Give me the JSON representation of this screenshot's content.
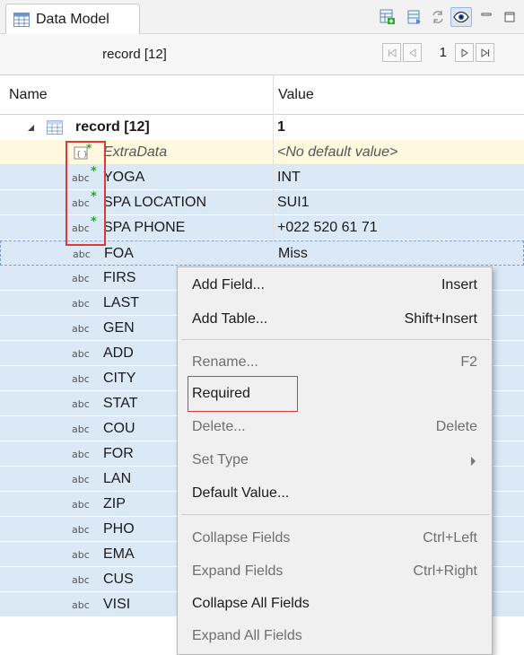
{
  "window": {
    "tab_label": "Data Model"
  },
  "nav": {
    "title": "record [12]",
    "page": "1"
  },
  "header": {
    "name": "Name",
    "value": "Value"
  },
  "tree": {
    "root": {
      "name": "record [12]",
      "value": "1"
    },
    "rows": [
      {
        "name": "ExtraData",
        "value": "<No default value>",
        "icon": "extradata-icon",
        "style": "extra"
      },
      {
        "name": "YOGA",
        "value": "INT",
        "icon": "abc-field-icon",
        "required": true
      },
      {
        "name": "SPA LOCATION",
        "value": "SUI1",
        "icon": "abc-field-icon",
        "required": true
      },
      {
        "name": "SPA PHONE",
        "value": "+022 520 61 71",
        "icon": "abc-field-icon",
        "required": true
      },
      {
        "name": "FOA",
        "value": "Miss",
        "icon": "abc-field-icon"
      },
      {
        "name": "FIRS",
        "value": "",
        "icon": "abc-field-icon"
      },
      {
        "name": "LAST",
        "value": "",
        "icon": "abc-field-icon"
      },
      {
        "name": "GEN",
        "value": "",
        "icon": "abc-field-icon"
      },
      {
        "name": "ADD",
        "value": "",
        "icon": "abc-field-icon"
      },
      {
        "name": "CITY",
        "value": "",
        "icon": "abc-field-icon"
      },
      {
        "name": "STAT",
        "value": "",
        "icon": "abc-field-icon"
      },
      {
        "name": "COU",
        "value": "",
        "icon": "abc-field-icon"
      },
      {
        "name": "FOR",
        "value": "",
        "icon": "abc-field-icon"
      },
      {
        "name": "LAN",
        "value": "",
        "icon": "abc-field-icon"
      },
      {
        "name": "ZIP",
        "value": "",
        "icon": "abc-field-icon"
      },
      {
        "name": "PHO",
        "value": "",
        "icon": "abc-field-icon"
      },
      {
        "name": "EMA",
        "value": "",
        "icon": "abc-field-icon"
      },
      {
        "name": "CUS",
        "value": "",
        "icon": "abc-field-icon"
      },
      {
        "name": "VISI",
        "value": "",
        "icon": "abc-field-icon"
      }
    ],
    "abc": "abc",
    "star": "*"
  },
  "menu": {
    "add_field": {
      "label": "Add Field...",
      "shortcut": "Insert"
    },
    "add_table": {
      "label": "Add Table...",
      "shortcut": "Shift+Insert"
    },
    "rename": {
      "label": "Rename...",
      "shortcut": "F2"
    },
    "required": {
      "label": "Required"
    },
    "delete": {
      "label": "Delete...",
      "shortcut": "Delete"
    },
    "set_type": {
      "label": "Set Type"
    },
    "default_value": {
      "label": "Default Value..."
    },
    "collapse_fields": {
      "label": "Collapse Fields",
      "shortcut": "Ctrl+Left"
    },
    "expand_fields": {
      "label": "Expand Fields",
      "shortcut": "Ctrl+Right"
    },
    "collapse_all": {
      "label": "Collapse All Fields"
    },
    "expand_all": {
      "label": "Expand All Fields"
    }
  },
  "colors": {
    "selection": "#dbe8f6",
    "extra_row": "#fdf8de",
    "highlight": "#d93a3a",
    "required_star": "#2aa52a"
  }
}
